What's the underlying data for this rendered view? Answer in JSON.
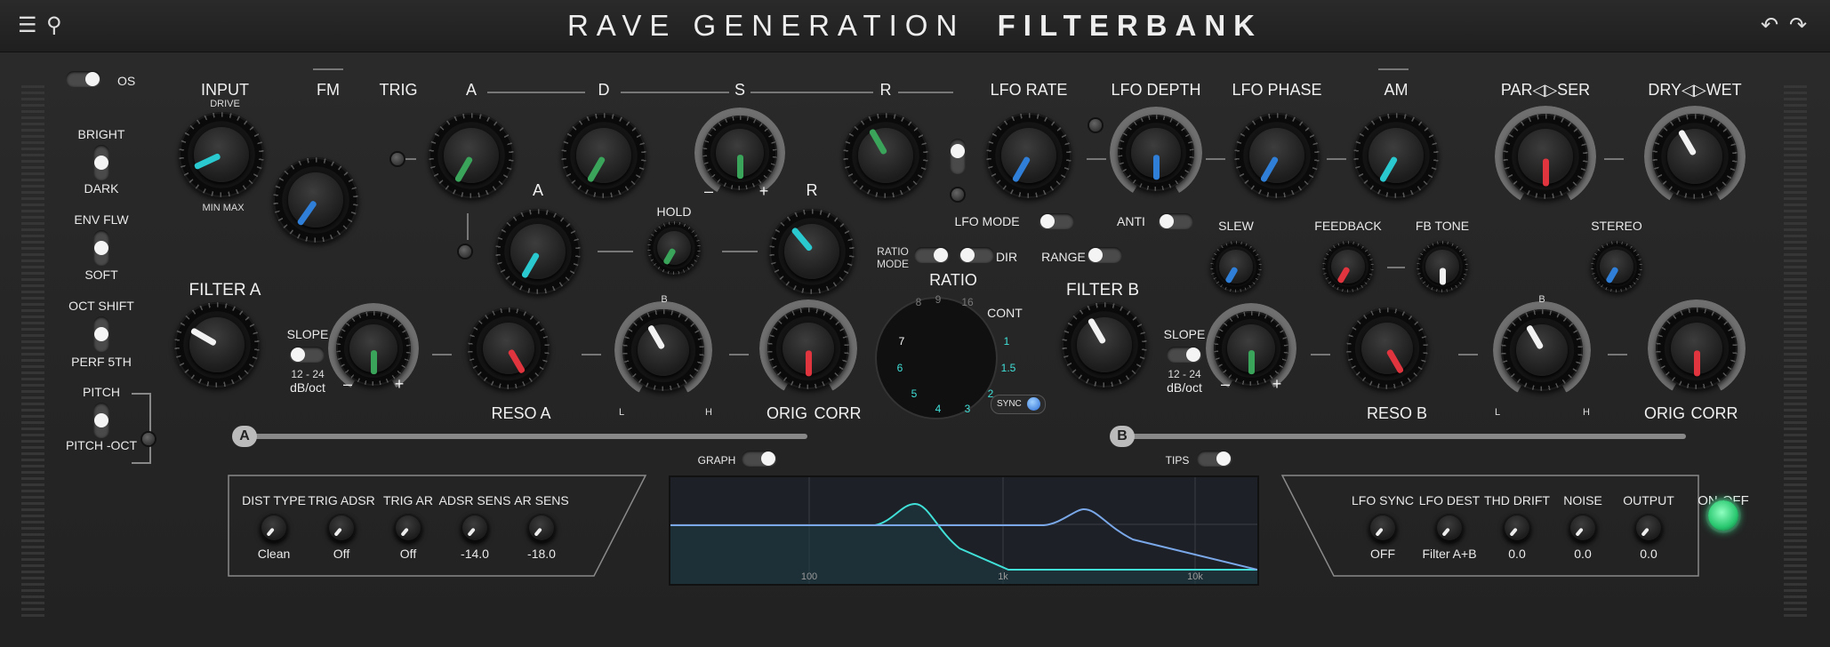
{
  "title": {
    "part1": "RAVE GENERATION",
    "part2": "FILTERBANK"
  },
  "icons": {
    "menu": "menu-icon",
    "search": "search-icon",
    "undo": "undo-icon",
    "redo": "redo-icon"
  },
  "colors": {
    "green": "#3aa55a",
    "blue": "#2f7fd8",
    "cyan": "#29c9cf",
    "red": "#e0343e",
    "white": "#f2f2f2",
    "onoff": "#3dff9c"
  },
  "left_switches": {
    "os": "OS",
    "bright": "BRIGHT",
    "dark": "DARK",
    "env_flw": "ENV FLW",
    "soft": "SOFT",
    "oct_shift": "OCT SHIFT",
    "perf_5th": "PERF 5TH",
    "pitch": "PITCH",
    "pitch_oct": "PITCH -OCT"
  },
  "top_labels": {
    "input": "INPUT",
    "drive": "DRIVE",
    "min_max": "MIN MAX",
    "fm": "FM",
    "trig": "TRIG",
    "a": "A",
    "d": "D",
    "s": "S",
    "r": "R",
    "a2": "A",
    "hold": "HOLD",
    "r2": "R",
    "minus": "–",
    "plus": "+",
    "lfo_rate": "LFO RATE",
    "lfo_depth": "LFO DEPTH",
    "lfo_phase": "LFO PHASE",
    "am": "AM",
    "par_ser": "PAR◁▷SER",
    "dry_wet": "DRY◁▷WET",
    "lfo_mode": "LFO MODE",
    "anti": "ANTI",
    "slew": "SLEW",
    "feedback": "FEEDBACK",
    "fb_tone": "FB TONE",
    "stereo": "STEREO"
  },
  "filter_a": {
    "title": "FILTER A",
    "slope": "SLOPE",
    "slope_val": "12 - 24",
    "slope_unit": "dB/oct",
    "reso": "RESO A",
    "orig": "ORIG",
    "corr": "CORR",
    "badge": "A",
    "b_glyph": "B",
    "l_glyph": "L",
    "h_glyph": "H"
  },
  "filter_b": {
    "title": "FILTER B",
    "slope": "SLOPE",
    "slope_val": "12 - 24",
    "slope_unit": "dB/oct",
    "reso": "RESO B",
    "orig": "ORIG",
    "corr": "CORR",
    "badge": "B",
    "b_glyph": "B",
    "l_glyph": "L",
    "h_glyph": "H"
  },
  "ratio": {
    "title": "RATIO",
    "ratio_mode": "RATIO\nMODE",
    "dir": "DIR",
    "range": "RANGE",
    "cont": "CONT",
    "sync": "SYNC",
    "numbers": [
      "8",
      "9",
      "16",
      "7",
      "6",
      "5",
      "4",
      "3",
      "2",
      "1.5",
      "1"
    ]
  },
  "graph": {
    "toggle_label": "GRAPH",
    "ticks": [
      "100",
      "1k",
      "10k"
    ]
  },
  "tips": {
    "label": "TIPS"
  },
  "bottom_left": [
    {
      "label": "DIST TYPE",
      "value": "Clean"
    },
    {
      "label": "TRIG ADSR",
      "value": "Off"
    },
    {
      "label": "TRIG AR",
      "value": "Off"
    },
    {
      "label": "ADSR SENS",
      "value": "-14.0"
    },
    {
      "label": "AR SENS",
      "value": "-18.0"
    }
  ],
  "bottom_right": [
    {
      "label": "LFO SYNC",
      "value": "OFF"
    },
    {
      "label": "LFO DEST",
      "value": "Filter A+B"
    },
    {
      "label": "THD DRIFT",
      "value": "0.0"
    },
    {
      "label": "NOISE",
      "value": "0.0"
    },
    {
      "label": "OUTPUT",
      "value": "0.0"
    }
  ],
  "on_off": {
    "label": "ON-OFF"
  }
}
